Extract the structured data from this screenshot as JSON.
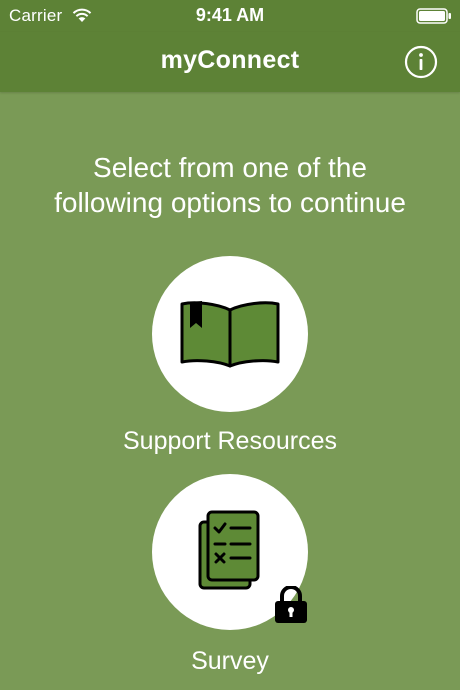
{
  "status_bar": {
    "carrier": "Carrier",
    "time": "9:41 AM"
  },
  "nav": {
    "title": "myConnect",
    "info_icon": "info-icon"
  },
  "prompt": "Select from one of the following options to continue",
  "options": [
    {
      "label": "Support Resources",
      "icon": "book-icon",
      "locked": false
    },
    {
      "label": "Survey",
      "icon": "checklist-icon",
      "locked": true
    }
  ],
  "colors": {
    "background": "#7a9a56",
    "header": "#5d8236",
    "icon_fill": "#5e8a36"
  }
}
